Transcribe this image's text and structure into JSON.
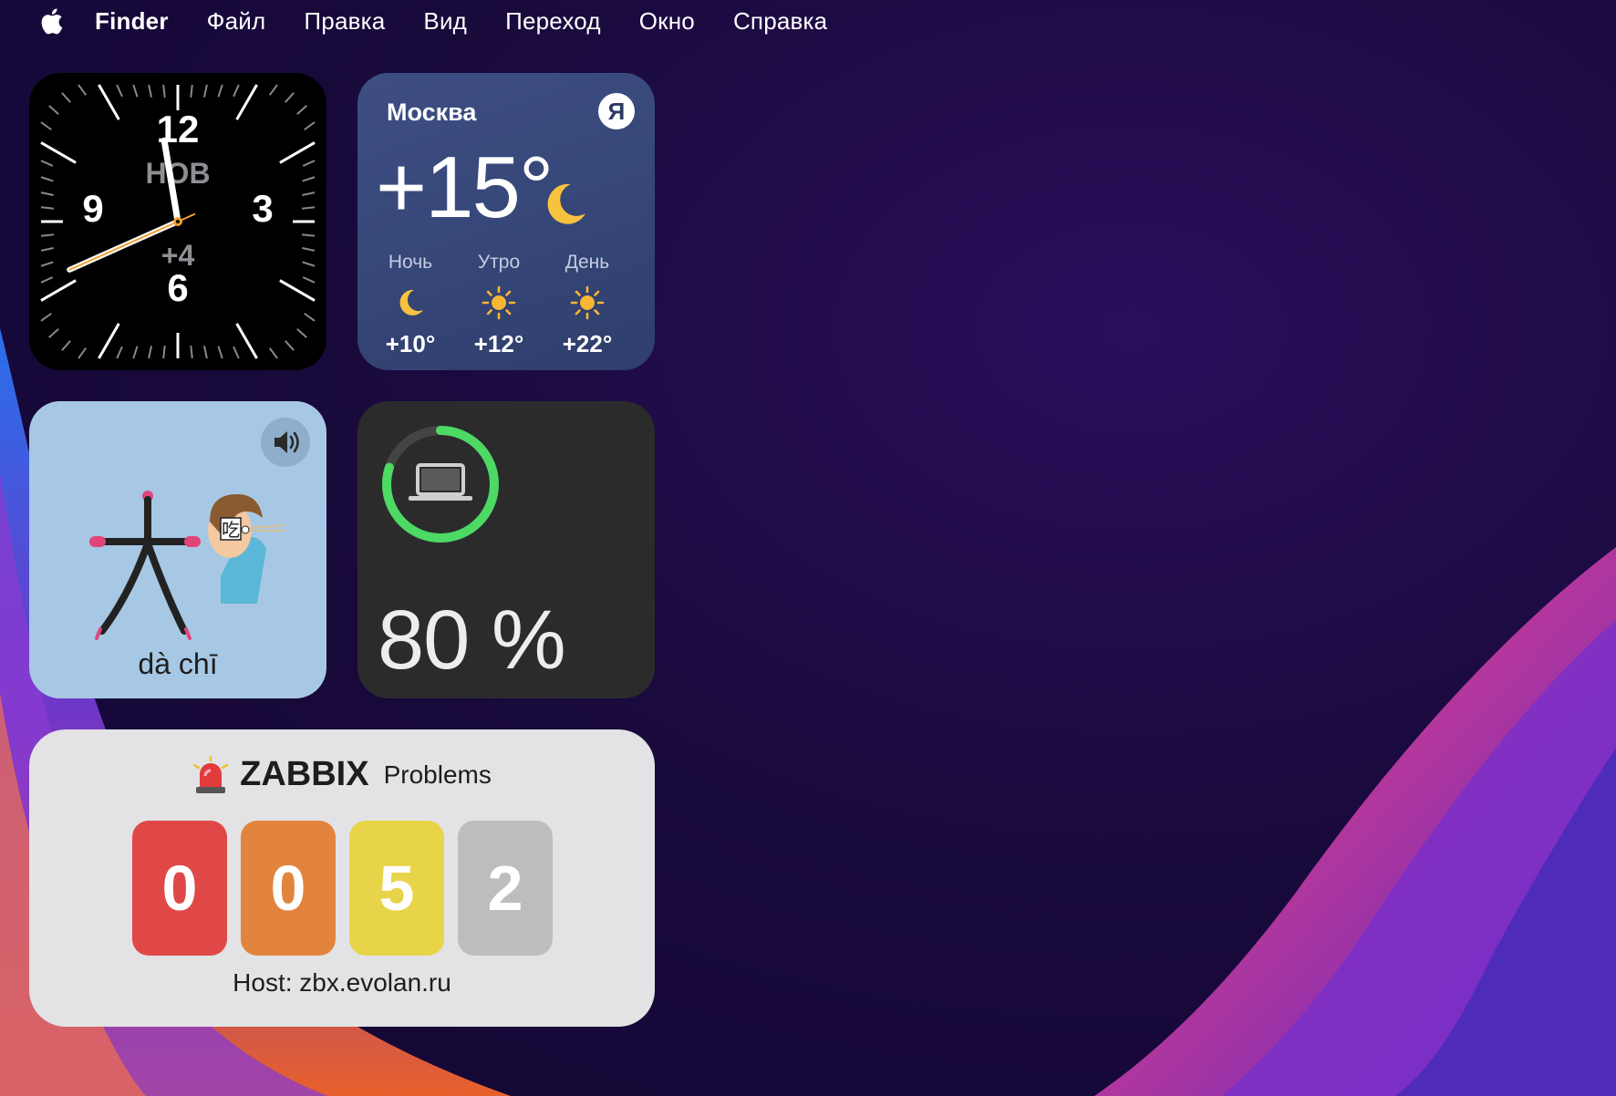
{
  "menubar": {
    "apple_icon": "apple-logo-icon",
    "items": [
      "Finder",
      "Файл",
      "Правка",
      "Вид",
      "Переход",
      "Окно",
      "Справка"
    ]
  },
  "clock_widget": {
    "numerals": [
      "12",
      "3",
      "6",
      "9"
    ],
    "city_code": "НОВ",
    "offset": "+4",
    "time": {
      "hour": 11,
      "minute": 41
    },
    "colors": {
      "hands": "#ffffff",
      "second_hand": "#f0a030"
    }
  },
  "weather_widget": {
    "city": "Москва",
    "provider_badge": "Я",
    "current_temp": "+15°",
    "current_icon": "moon-icon",
    "periods": [
      {
        "label": "Ночь",
        "icon": "moon-icon",
        "temp": "+10°"
      },
      {
        "label": "Утро",
        "icon": "sun-icon",
        "temp": "+12°"
      },
      {
        "label": "День",
        "icon": "sun-icon",
        "temp": "+22°"
      }
    ]
  },
  "chinese_widget": {
    "characters": [
      "大",
      "吃"
    ],
    "pinyin": "dà chī",
    "speaker_icon": "speaker-icon"
  },
  "battery_widget": {
    "device_icon": "laptop-icon",
    "percent_text": "80 %",
    "level": 0.8,
    "ring_color": "#4cd964"
  },
  "zabbix_widget": {
    "icon": "siren-icon",
    "title": "ZABBIX",
    "subtitle": "Problems",
    "counts": [
      {
        "value": "0",
        "color": "#e04848"
      },
      {
        "value": "0",
        "color": "#e2843e"
      },
      {
        "value": "5",
        "color": "#e8d448"
      },
      {
        "value": "2",
        "color": "#bdbdbd"
      }
    ],
    "host": "Host: zbx.evolan.ru"
  }
}
